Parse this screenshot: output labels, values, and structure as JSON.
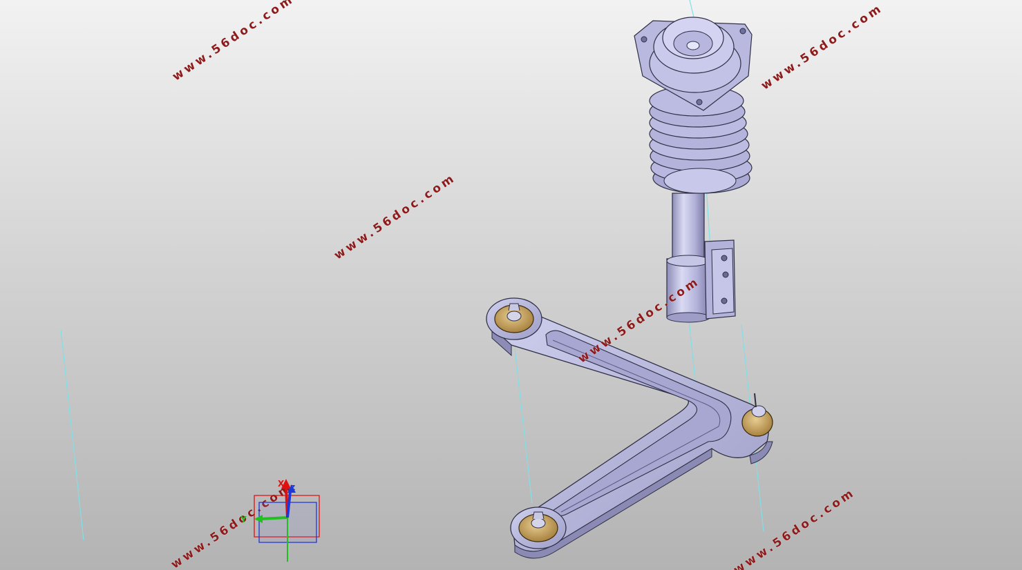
{
  "app": {
    "window_title": ""
  },
  "viewport": {
    "background_top": "#f2f2f2",
    "background_bottom": "#b3b3b3",
    "part_color": "#b6b6dc",
    "part_edge": "#2e2e44",
    "bushing_color": "#c9a465",
    "construction_line_color": "#7fe0e8"
  },
  "watermarks": [
    {
      "text": "www.56doc.com"
    },
    {
      "text": "www.56doc.com"
    },
    {
      "text": "www.56doc.com"
    },
    {
      "text": "www.56doc.com"
    },
    {
      "text": "www.56doc.com"
    },
    {
      "text": "www.56doc.com"
    }
  ],
  "compass": {
    "x_label": "X",
    "y_label": "Y",
    "z_label": "Z",
    "x_color": "#e01010",
    "y_color": "#1fc01f",
    "z_color": "#1d37d8"
  },
  "model": {
    "parts": [
      {
        "name": "strut-top-mount",
        "icon": "mount-plate-icon"
      },
      {
        "name": "coil-spring",
        "icon": "spring-icon"
      },
      {
        "name": "shock-absorber",
        "icon": "damper-icon"
      },
      {
        "name": "knuckle-bracket",
        "icon": "bracket-icon"
      },
      {
        "name": "lower-control-arm",
        "icon": "a-arm-icon"
      },
      {
        "name": "ball-joint",
        "icon": "ball-joint-icon"
      },
      {
        "name": "bushing-front",
        "icon": "bushing-icon"
      },
      {
        "name": "bushing-rear",
        "icon": "bushing-icon"
      }
    ]
  }
}
